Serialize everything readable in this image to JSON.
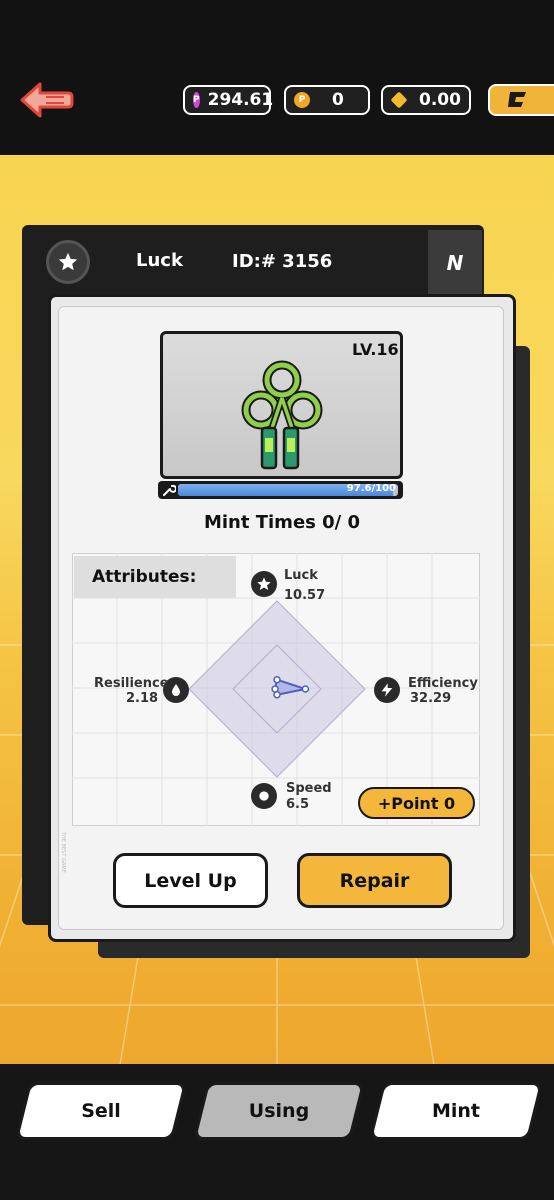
{
  "header": {
    "currencies": [
      {
        "name": "p-token-icon",
        "value": "294.61",
        "color": "#c74bd6"
      },
      {
        "name": "p-coin-icon",
        "value": "0",
        "color": "#f2a623"
      },
      {
        "name": "bnb-icon",
        "value": "0.00",
        "color": "#f3ba2f"
      }
    ]
  },
  "card": {
    "type": "Luck",
    "id": "ID:# 3156",
    "rarity": "N",
    "level": "LV.16",
    "durability_text": "97.6/100",
    "durability_fraction": 0.976,
    "mint_times": "Mint Times 0/ 0"
  },
  "attributes": {
    "title": "Attributes:",
    "stats": [
      {
        "key": "luck",
        "label": "Luck",
        "value": "10.57"
      },
      {
        "key": "efficiency",
        "label": "Efficiency",
        "value": "32.29"
      },
      {
        "key": "speed",
        "label": "Speed",
        "value": "6.5"
      },
      {
        "key": "resilience",
        "label": "Resilience",
        "value": "2.18"
      }
    ],
    "point_button": "+Point 0",
    "radar_max": 100
  },
  "actions": {
    "level_up": "Level Up",
    "repair": "Repair"
  },
  "watermark": "THE BEST GAME",
  "nav": {
    "tabs": [
      "Sell",
      "Using",
      "Mint"
    ],
    "active": "Using"
  },
  "colors": {
    "accent": "#f4b73b",
    "dark": "#1a1a1a",
    "radar_fill": "#b9b3d6",
    "radar_line": "#4f5fbf"
  }
}
